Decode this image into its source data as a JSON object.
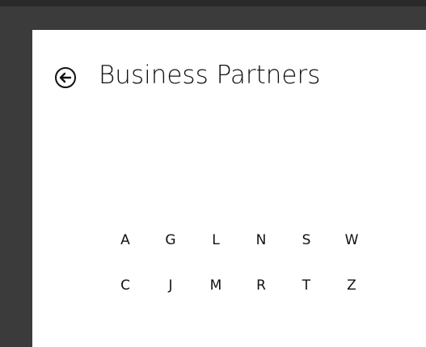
{
  "header": {
    "back_icon": "back-arrow-circle-icon",
    "title": "Business Partners"
  },
  "index": {
    "rows": [
      [
        "A",
        "G",
        "L",
        "N",
        "S",
        "W"
      ],
      [
        "C",
        "J",
        "M",
        "R",
        "T",
        "Z"
      ]
    ]
  }
}
